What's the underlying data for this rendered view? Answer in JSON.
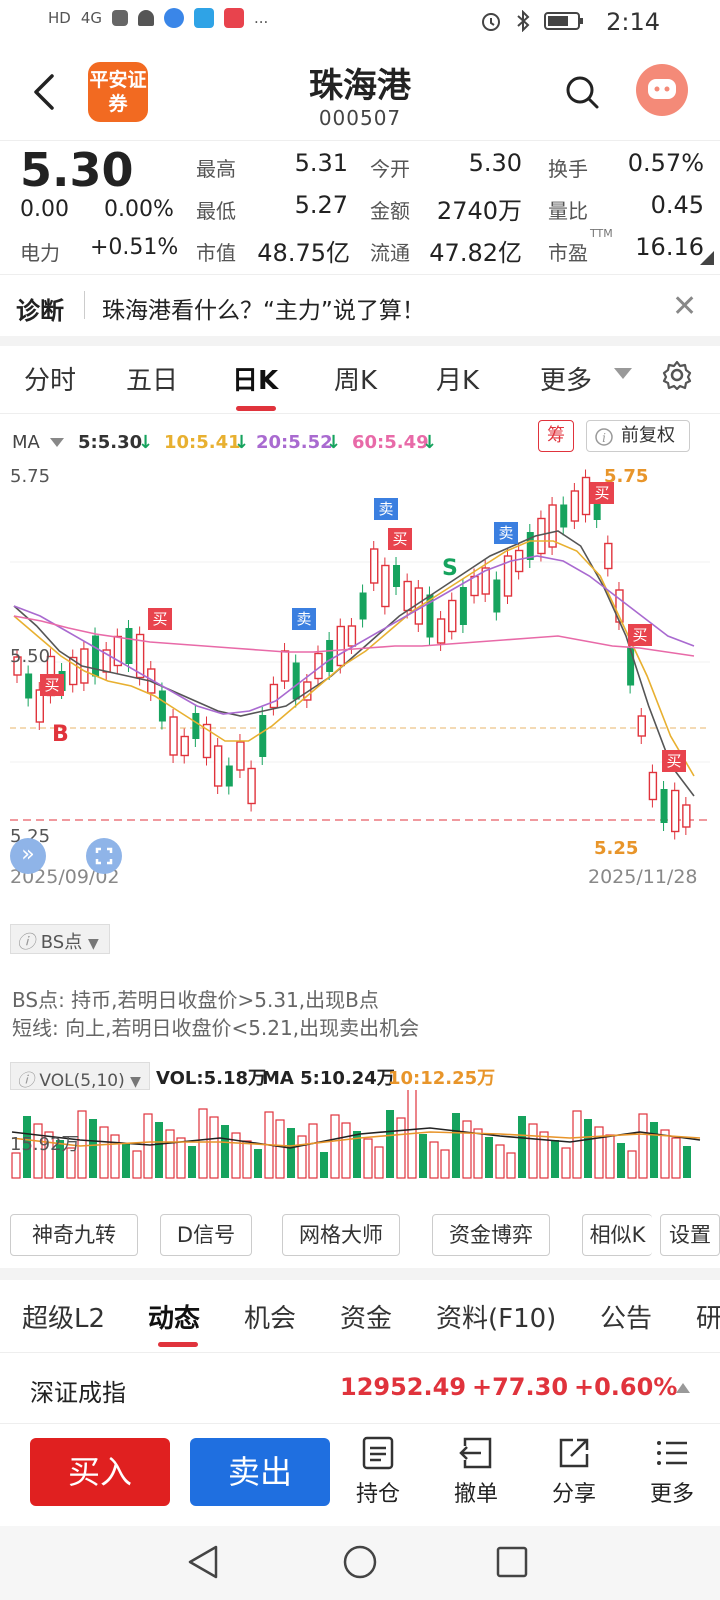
{
  "status_bar": {
    "left_labels": [
      "HD",
      "4G",
      "..."
    ],
    "time": "2:14"
  },
  "header": {
    "logo_text": "平安证券",
    "title": "珠海港",
    "code": "000507"
  },
  "quote": {
    "price": "5.30",
    "change": "0.00",
    "change_pct": "0.00%",
    "sector_label": "电力",
    "sector_change": "+0.51%",
    "fields": [
      {
        "label": "最高",
        "value": "5.31",
        "color": "#e0333c"
      },
      {
        "label": "今开",
        "value": "5.30",
        "color": "#222222"
      },
      {
        "label": "换手",
        "value": "0.57%",
        "color": "#222222"
      },
      {
        "label": "最低",
        "value": "5.27",
        "color": "#16a35e"
      },
      {
        "label": "金额",
        "value": "2740万",
        "color": "#222222"
      },
      {
        "label": "量比",
        "value": "0.45",
        "color": "#222222"
      },
      {
        "label": "市值",
        "value": "48.75亿",
        "color": "#222222"
      },
      {
        "label": "流通",
        "value": "47.82亿",
        "color": "#222222"
      },
      {
        "label": "市盈",
        "value": "16.16",
        "color": "#222222"
      }
    ],
    "pe_sup": "TTM"
  },
  "diagnosis": {
    "tag": "诊断",
    "text": "珠海港看什么？“主力”说了算！"
  },
  "period_tabs": [
    "分时",
    "五日",
    "日K",
    "周K",
    "月K",
    "更多"
  ],
  "ma": {
    "label": "MA",
    "items": [
      {
        "text": "5:5.30",
        "color": "#333333"
      },
      {
        "text": "10:5.41",
        "color": "#e8b030"
      },
      {
        "text": "20:5.52",
        "color": "#a96ad0"
      },
      {
        "text": "60:5.49",
        "color": "#e86aa8"
      }
    ],
    "chip_chou": "筹",
    "chip_fuquan": "前复权"
  },
  "chart_data": {
    "type": "candlestick",
    "y_labels": [
      "5.75",
      "5.50",
      "5.25"
    ],
    "high_marker": "5.75",
    "low_marker": "5.25",
    "date_start": "2025/09/02",
    "date_end": "2025/11/28",
    "signals": [
      "买",
      "卖",
      "卖",
      "卖",
      "买",
      "买",
      "买",
      "买",
      "买"
    ],
    "letter_signals": [
      "B",
      "S"
    ]
  },
  "bs_panel": {
    "chip": "BS点",
    "line1": "BS点: 持币,若明日收盘价>5.31,出现B点",
    "line2": "短线: 向上,若明日收盘价<5.21,出现卖出机会"
  },
  "volume": {
    "chip": "VOL(5,10)",
    "vol_text": "VOL:5.18万",
    "ma5_text": "MA 5:10.24万",
    "ma10_text": "10:12.25万",
    "axis_label": "15.92万"
  },
  "tool_buttons": [
    "神奇九转",
    "D信号",
    "网格大师",
    "资金博弈",
    "相似K",
    "设置"
  ],
  "lower_tabs": [
    "超级L2",
    "动态",
    "机会",
    "资金",
    "资料(F10)",
    "公告",
    "研"
  ],
  "index": {
    "name": "深证成指",
    "value": "12952.49",
    "change": "+77.30",
    "change_pct": "+0.60%"
  },
  "actions": {
    "buy": "买入",
    "sell": "卖出",
    "items": [
      {
        "label": "持仓",
        "icon": "holdings-icon"
      },
      {
        "label": "撤单",
        "icon": "cancel-order-icon"
      },
      {
        "label": "分享",
        "icon": "share-icon"
      },
      {
        "label": "更多",
        "icon": "menu-icon"
      }
    ]
  }
}
